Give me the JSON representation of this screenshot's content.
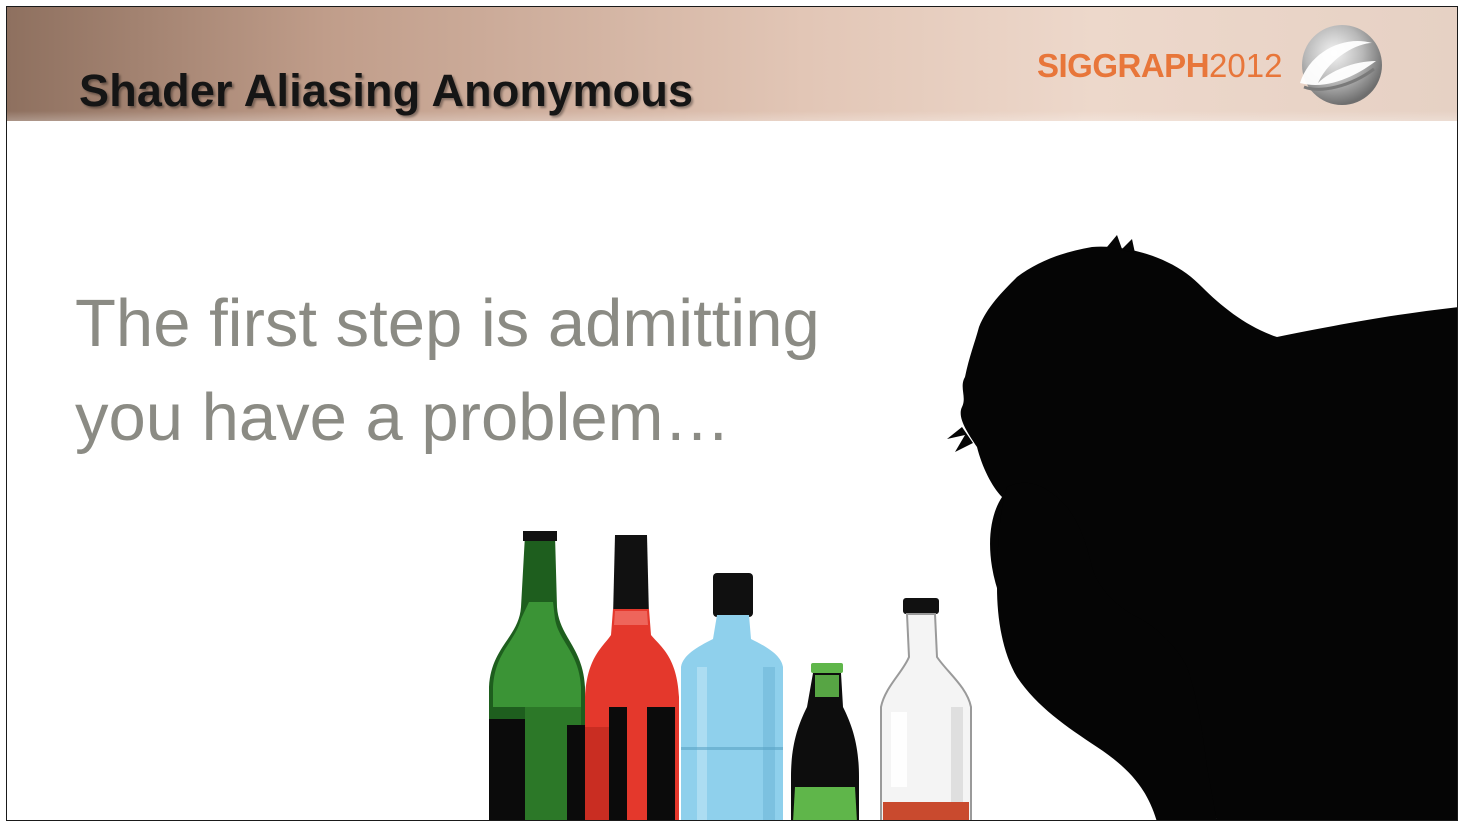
{
  "slide": {
    "title": "Shader Aliasing Anonymous",
    "logo": {
      "brand": "SIGGRAPH",
      "year": "2012",
      "color": "#e8763a"
    },
    "body_lines": [
      "The first step is admitting",
      "you have a problem…"
    ],
    "header_gradient": [
      "#8e705f",
      "#e2c6b6",
      "#edd8cb"
    ],
    "body_text_color": "#8b8b84"
  },
  "illustration": {
    "bottles": [
      {
        "name": "green-wine-bottle",
        "color": "#2f7d2a"
      },
      {
        "name": "red-wine-bottle",
        "color": "#e4382c"
      },
      {
        "name": "blue-gin-bottle",
        "color": "#8fd0ec"
      },
      {
        "name": "small-green-bottle",
        "color": "#5fb64a"
      },
      {
        "name": "clear-whisky-bottle",
        "color": "#c94a2e"
      }
    ],
    "figure": "silhouette-of-person-holding-head"
  }
}
